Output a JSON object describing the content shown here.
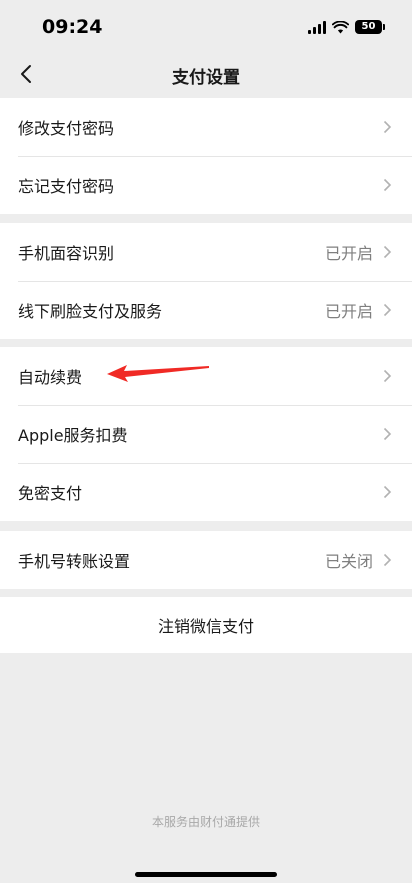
{
  "status_bar": {
    "time": "09:24",
    "battery": "50"
  },
  "nav": {
    "title": "支付设置"
  },
  "groups": [
    {
      "items": [
        {
          "label": "修改支付密码",
          "value": ""
        },
        {
          "label": "忘记支付密码",
          "value": ""
        }
      ]
    },
    {
      "items": [
        {
          "label": "手机面容识别",
          "value": "已开启"
        },
        {
          "label": "线下刷脸支付及服务",
          "value": "已开启"
        }
      ]
    },
    {
      "items": [
        {
          "label": "自动续费",
          "value": ""
        },
        {
          "label": "Apple服务扣费",
          "value": ""
        },
        {
          "label": "免密支付",
          "value": ""
        }
      ]
    },
    {
      "items": [
        {
          "label": "手机号转账设置",
          "value": "已关闭"
        }
      ]
    }
  ],
  "deregister_label": "注销微信支付",
  "footer": "本服务由财付通提供",
  "colors": {
    "background": "#ededed",
    "annotation_arrow": "#f02a25"
  }
}
